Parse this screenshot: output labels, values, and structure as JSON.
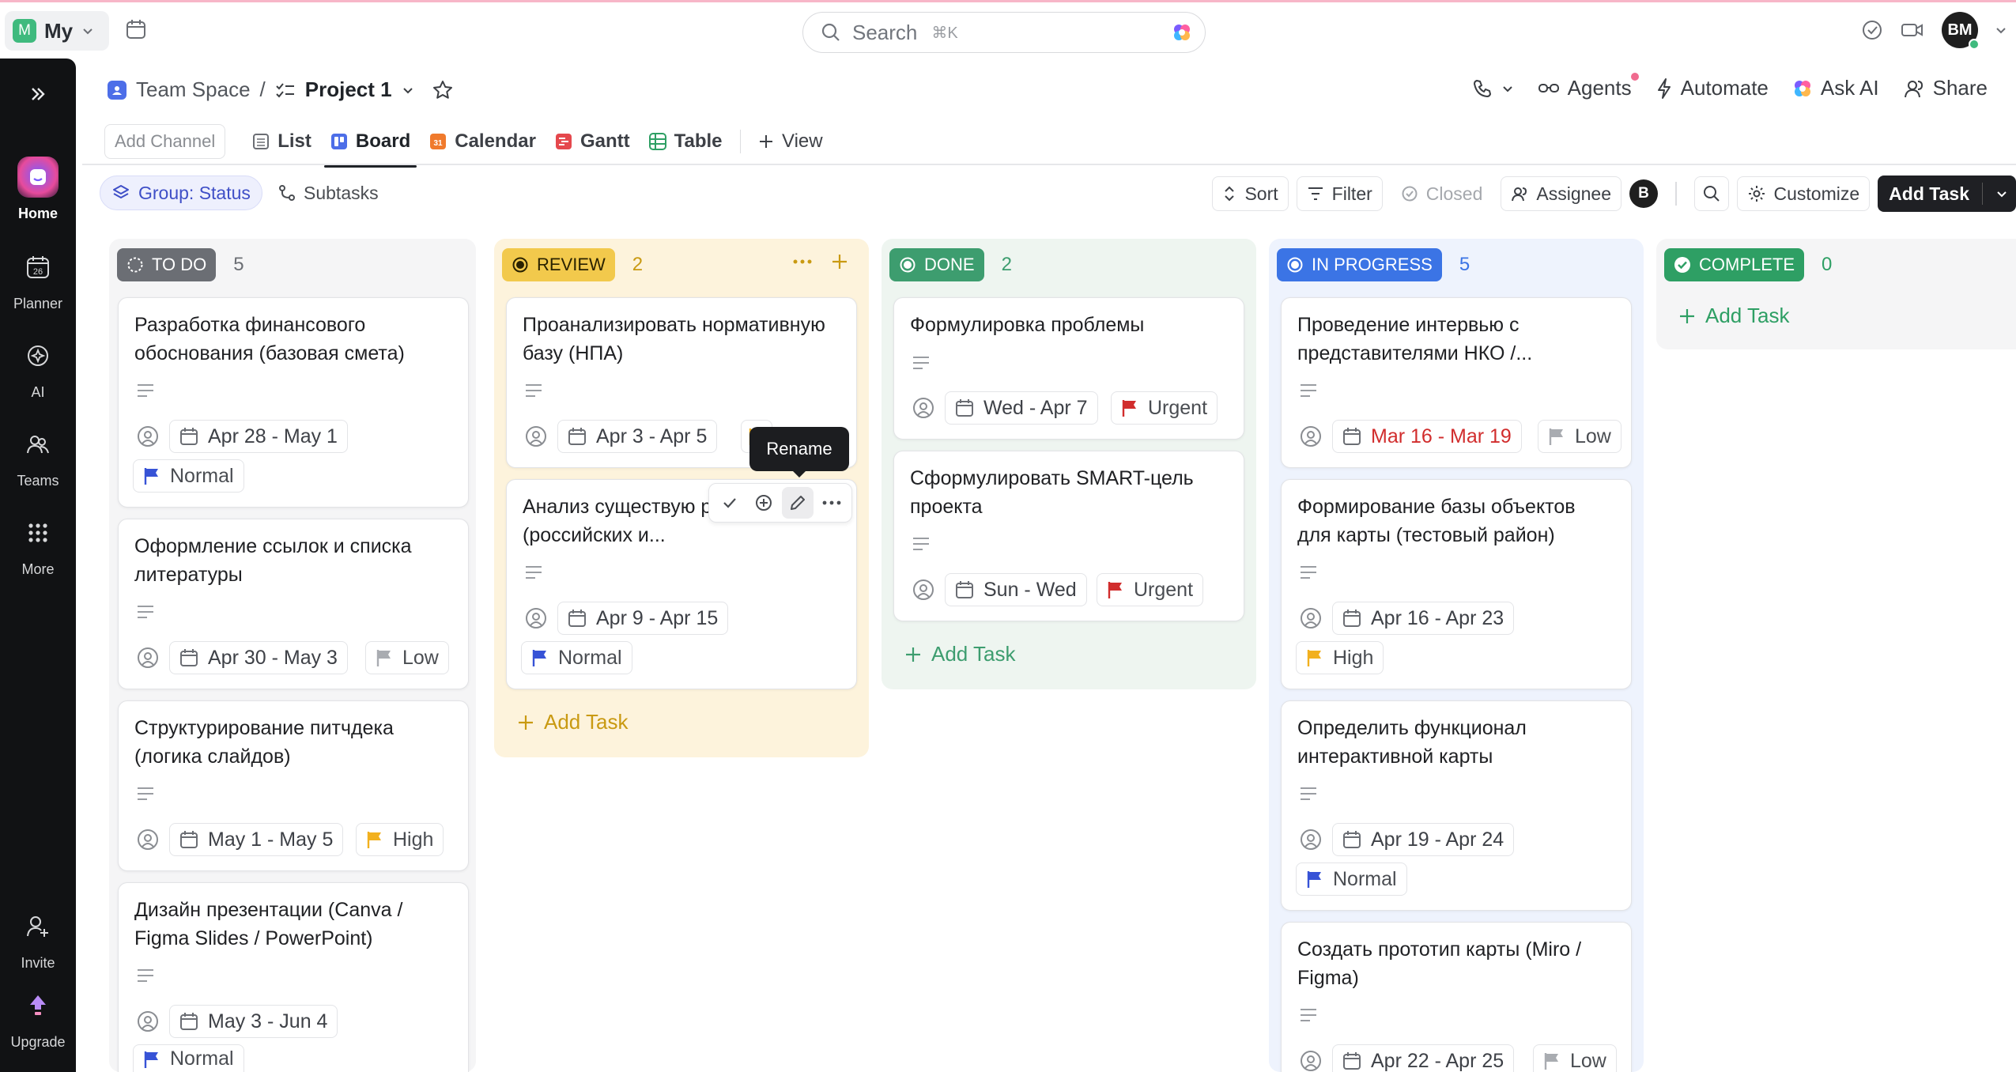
{
  "topbar": {
    "workspace_initial": "M",
    "workspace_name": "My",
    "search_placeholder": "Search",
    "search_shortcut": "⌘K",
    "user_initials": "BM"
  },
  "rail": {
    "items": [
      {
        "label": "Home",
        "icon": "home-icon"
      },
      {
        "label": "Planner",
        "icon": "calendar-icon",
        "date": "26"
      },
      {
        "label": "AI",
        "icon": "ai-icon"
      },
      {
        "label": "Teams",
        "icon": "teams-icon"
      },
      {
        "label": "More",
        "icon": "grid-icon"
      }
    ],
    "invite_label": "Invite",
    "upgrade_label": "Upgrade"
  },
  "header": {
    "space": "Team Space",
    "separator": "/",
    "project": "Project 1",
    "agents": "Agents",
    "automate": "Automate",
    "ask_ai": "Ask AI",
    "share": "Share"
  },
  "views": {
    "add_channel": "Add Channel",
    "tabs": [
      "List",
      "Board",
      "Calendar",
      "Gantt",
      "Table"
    ],
    "calendar_badge": "31",
    "add_view": "View",
    "active": "Board"
  },
  "filters": {
    "group": "Group: Status",
    "subtasks": "Subtasks",
    "sort": "Sort",
    "filter": "Filter",
    "closed": "Closed",
    "assignee": "Assignee",
    "assignee_avatar": "B",
    "customize": "Customize",
    "add_task": "Add Task"
  },
  "colors": {
    "todo": "#6b6e74",
    "review": "#f2c94c",
    "done": "#3d9d6f",
    "in_progress": "#3b74e5",
    "complete": "#2e9f64",
    "urgent": "#d12d2d",
    "high": "#f2b01e",
    "normal": "#3753d6",
    "low": "#a9acb1"
  },
  "columns": [
    {
      "status": "TO DO",
      "count": "5",
      "cards": [
        {
          "title": "Разработка финансового обоснования (базовая смета)",
          "date": "Apr 28 - May 1",
          "priority": "Normal"
        },
        {
          "title": "Оформление ссылок и списка литературы",
          "date": "Apr 30 - May 3",
          "priority": "Low"
        },
        {
          "title": "Структурирование питчдека (логика слайдов)",
          "date": "May 1 - May 5",
          "priority": "High"
        },
        {
          "title": "Дизайн презентации (Canva / Figma Slides / PowerPoint)",
          "date": "May 3 - Jun 4",
          "priority": "Normal"
        }
      ]
    },
    {
      "status": "REVIEW",
      "count": "2",
      "cards": [
        {
          "title": "Проанализировать нормативную базу (НПА)",
          "date": "Apr 3 - Apr 5"
        },
        {
          "title": "Анализ существую решений (российских и...",
          "date": "Apr 9 - Apr 15",
          "priority": "Normal"
        }
      ],
      "add_task": "Add Task"
    },
    {
      "status": "DONE",
      "count": "2",
      "cards": [
        {
          "title": "Формулировка проблемы",
          "date": "Wed - Apr 7",
          "priority": "Urgent"
        },
        {
          "title": "Сформулировать SMART-цель проекта",
          "date": "Sun - Wed",
          "priority": "Urgent"
        }
      ],
      "add_task": "Add Task"
    },
    {
      "status": "IN PROGRESS",
      "count": "5",
      "cards": [
        {
          "title": "Проведение интервью с представителями НКО /...",
          "date": "Mar 16 - Mar 19",
          "priority": "Low"
        },
        {
          "title": "Формирование базы объектов для карты (тестовый район)",
          "date": "Apr 16 - Apr 23",
          "priority": "High"
        },
        {
          "title": "Определить функционал интерактивной карты",
          "date": "Apr 19 - Apr 24",
          "priority": "Normal"
        },
        {
          "title": "Создать прототип карты (Miro / Figma)",
          "date": "Apr 22 - Apr 25",
          "priority": "Low"
        }
      ]
    },
    {
      "status": "COMPLETE",
      "count": "0",
      "add_task": "Add Task"
    }
  ],
  "tooltip": "Rename"
}
